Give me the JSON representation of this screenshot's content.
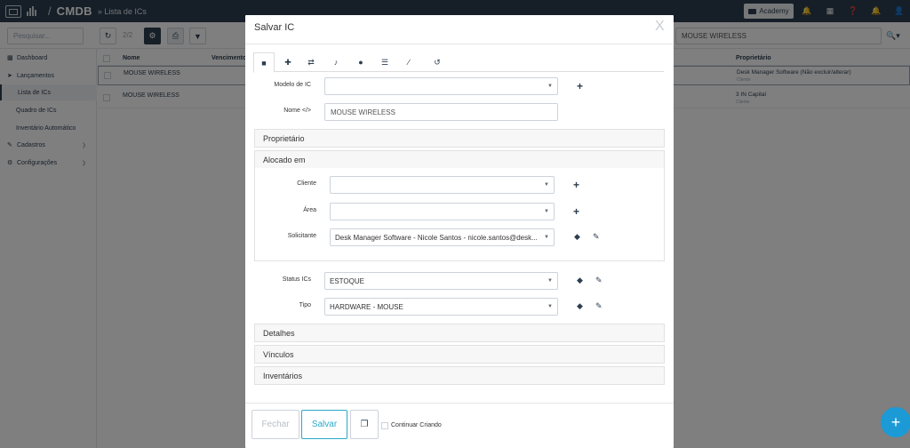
{
  "app": {
    "module": "CMDB",
    "separator": "/",
    "crumb": "» Lista de ICs",
    "academy_label": "Academy"
  },
  "toolbar": {
    "search_placeholder": "Pesquisar...",
    "pager": "2/2",
    "right_search_value": "MOUSE WIRELESS"
  },
  "sidebar": {
    "items": [
      {
        "label": "Dashboard",
        "icon": "dashboard-icon"
      },
      {
        "label": "Lançamentos",
        "icon": "send-icon"
      },
      {
        "label": "Lista de ICs"
      },
      {
        "label": "Quadro de ICs"
      },
      {
        "label": "Inventário Automático"
      },
      {
        "label": "Cadastros",
        "icon": "edit-icon"
      },
      {
        "label": "Configurações",
        "icon": "gear-icon"
      }
    ]
  },
  "grid": {
    "headers": {
      "name": "Nome",
      "due": "Vencimento",
      "owner": "Proprietário"
    },
    "rows": [
      {
        "name": "MOUSE WIRELESS",
        "owner": "Desk Manager Software (Não excluir/alterar)",
        "owner_sub": "Cliente"
      },
      {
        "name": "MOUSE WIRELESS",
        "owner": "3 IN Capital",
        "owner_sub": "Cliente"
      }
    ]
  },
  "modal": {
    "title": "Salvar IC",
    "close": "X",
    "fields": {
      "modelo_label": "Modelo de IC",
      "modelo_value": "",
      "nome_label": "Nome",
      "nome_code_glyph": "</>",
      "nome_value": "MOUSE WIRELESS",
      "cliente_label": "Cliente",
      "cliente_value": "",
      "area_label": "Área",
      "area_value": "",
      "solicitante_label": "Solicitante",
      "solicitante_value": "Desk Manager Software - Nicole Santos - nicole.santos@desk...",
      "status_label": "Status ICs",
      "status_value": "ESTOQUE",
      "tipo_label": "Tipo",
      "tipo_value": "HARDWARE - MOUSE"
    },
    "panels": {
      "proprietario": "Proprietário",
      "alocado": "Alocado em",
      "detalhes": "Detalhes",
      "vinculos": "Vínculos",
      "inventarios": "Inventários"
    },
    "footer": {
      "fechar": "Fechar",
      "salvar": "Salvar",
      "continuar": "Continuar Criando"
    }
  },
  "colors": {
    "navy": "#2c3e50",
    "accent": "#1b9ad6",
    "salvar": "#2aa9c9"
  }
}
